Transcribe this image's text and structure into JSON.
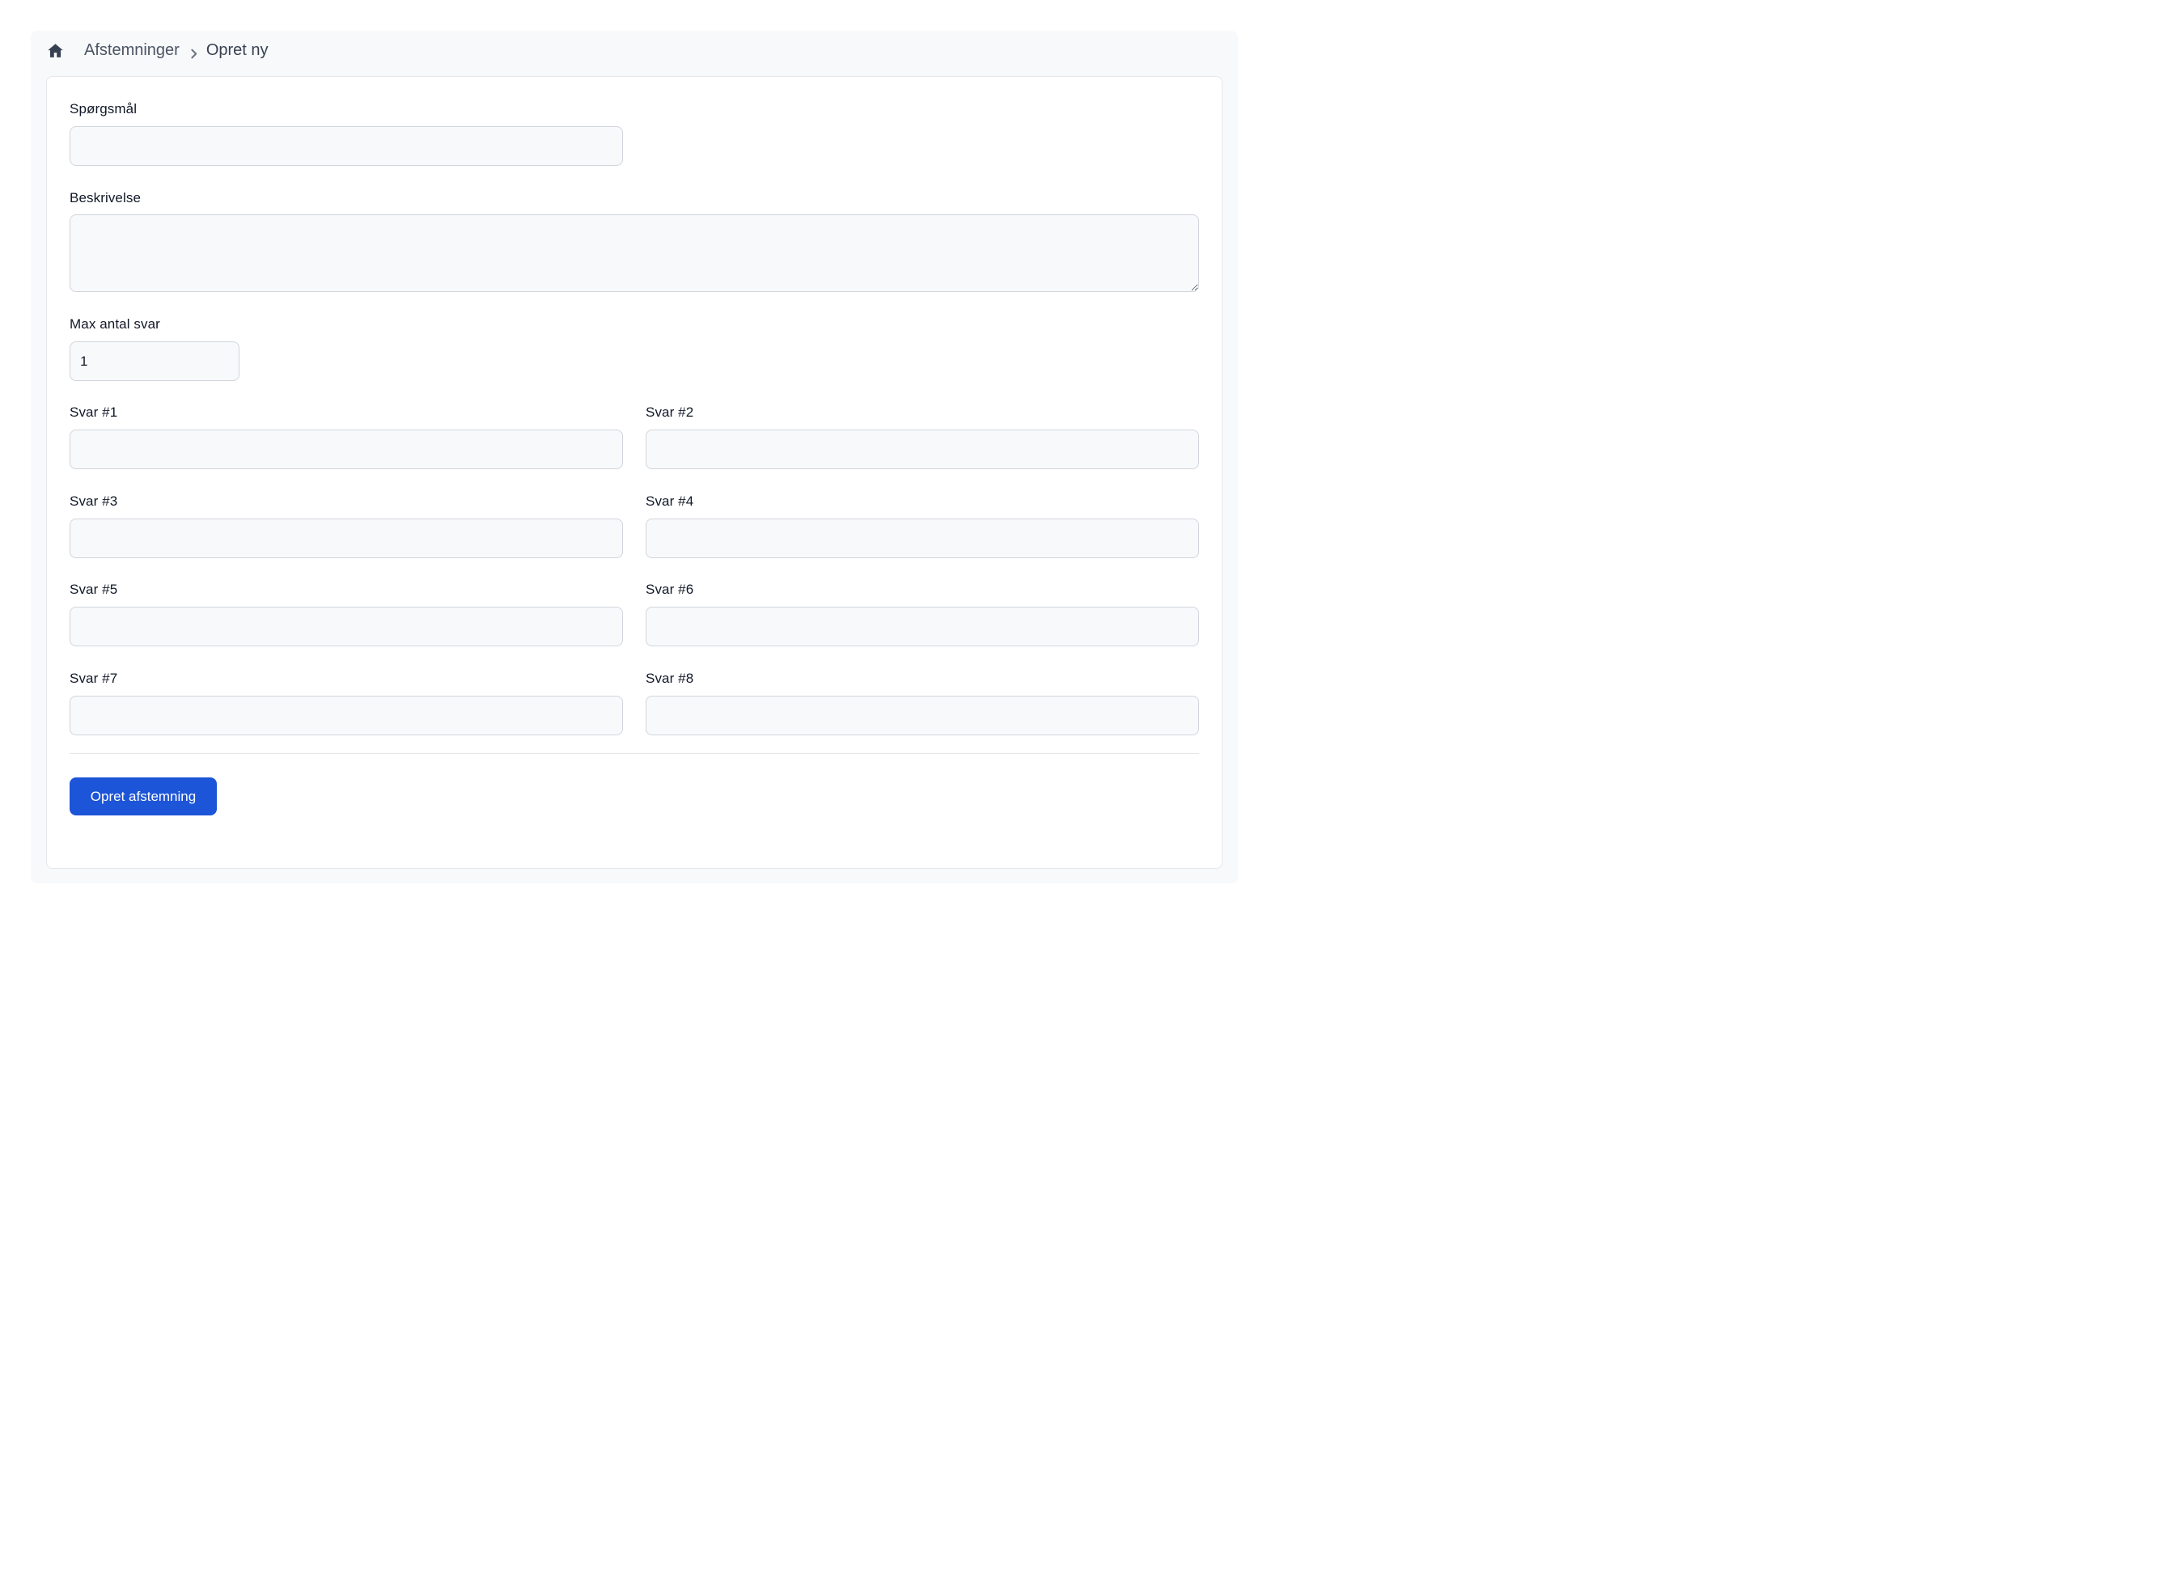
{
  "breadcrumb": {
    "home_icon": "home-icon",
    "items": [
      "Afstemninger",
      "Opret ny"
    ],
    "separator_icon": "chevron-right-icon"
  },
  "form": {
    "question": {
      "label": "Spørgsmål",
      "value": ""
    },
    "description": {
      "label": "Beskrivelse",
      "value": ""
    },
    "max_answers": {
      "label": "Max antal svar",
      "value": "1"
    },
    "answers": [
      {
        "label": "Svar #1",
        "value": ""
      },
      {
        "label": "Svar #2",
        "value": ""
      },
      {
        "label": "Svar #3",
        "value": ""
      },
      {
        "label": "Svar #4",
        "value": ""
      },
      {
        "label": "Svar #5",
        "value": ""
      },
      {
        "label": "Svar #6",
        "value": ""
      },
      {
        "label": "Svar #7",
        "value": ""
      },
      {
        "label": "Svar #8",
        "value": ""
      }
    ],
    "submit_label": "Opret afstemning"
  },
  "colors": {
    "primary": "#1d55d8",
    "panel_bg": "#f8f9fb",
    "border": "#d1d5db"
  }
}
